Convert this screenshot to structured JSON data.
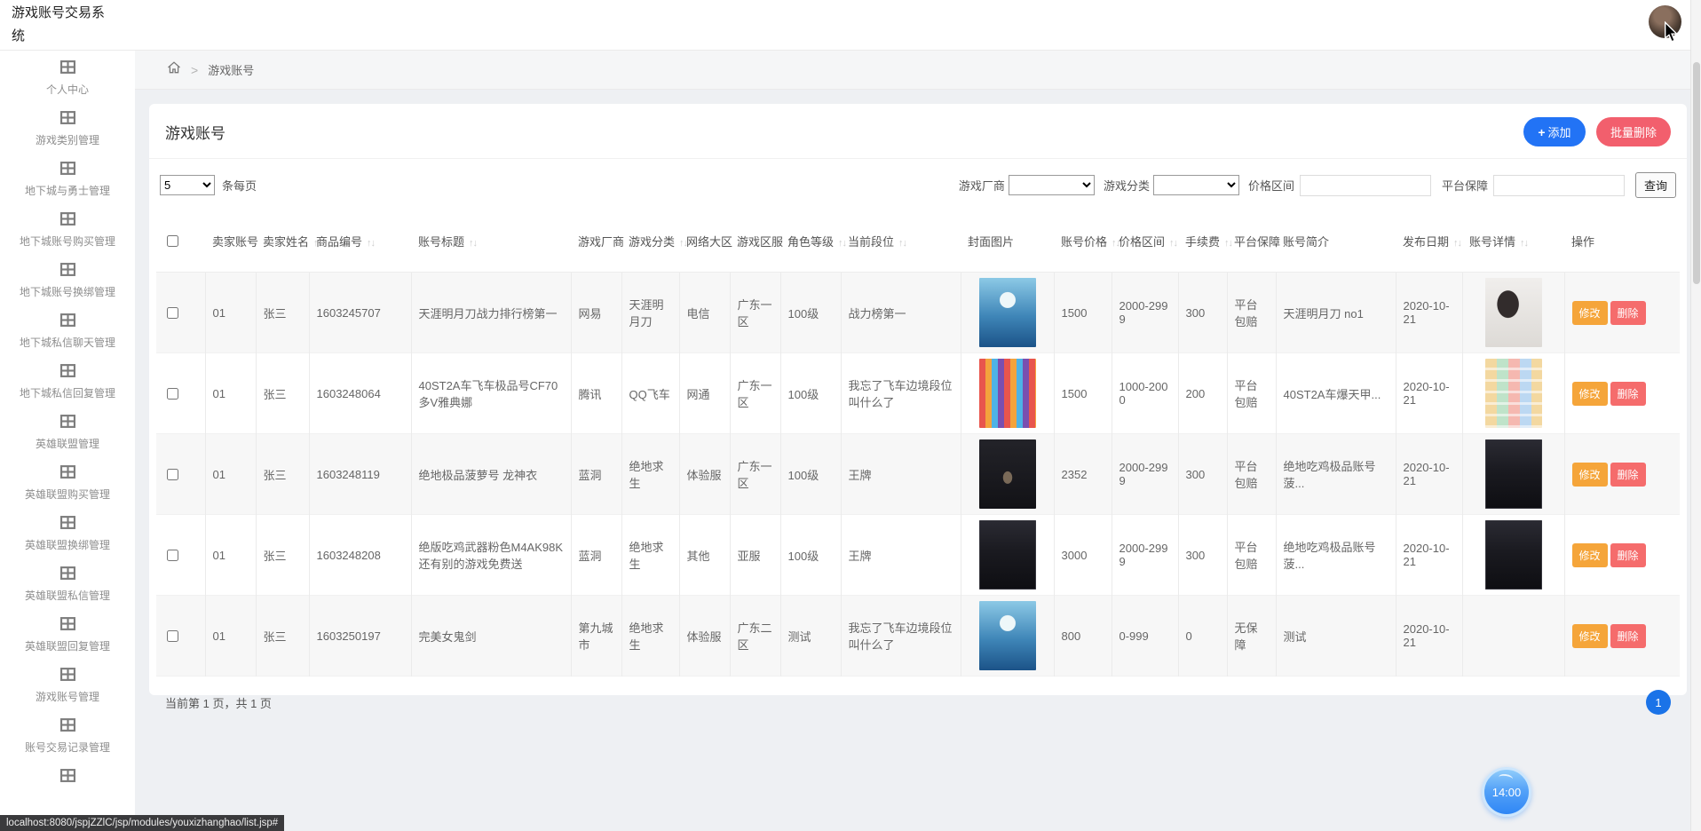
{
  "colors": {
    "primary_blue": "#2273f5",
    "danger_red": "#f25f6d",
    "warning_orange": "#f5a53a",
    "pagination_blue": "#1a73e8"
  },
  "header": {
    "app_title": "游戏账号交易系统"
  },
  "sidebar": {
    "items": [
      {
        "label": "个人中心"
      },
      {
        "label": "游戏类别管理"
      },
      {
        "label": "地下城与勇士管理"
      },
      {
        "label": "地下城账号购买管理"
      },
      {
        "label": "地下城账号换绑管理"
      },
      {
        "label": "地下城私信聊天管理"
      },
      {
        "label": "地下城私信回复管理"
      },
      {
        "label": "英雄联盟管理"
      },
      {
        "label": "英雄联盟购买管理"
      },
      {
        "label": "英雄联盟换绑管理"
      },
      {
        "label": "英雄联盟私信管理"
      },
      {
        "label": "英雄联盟回复管理"
      },
      {
        "label": "游戏账号管理"
      },
      {
        "label": "账号交易记录管理"
      },
      {
        "label": ""
      }
    ]
  },
  "breadcrumb": {
    "current": "游戏账号"
  },
  "page": {
    "title": "游戏账号",
    "add_label": "添加",
    "batch_delete_label": "批量删除"
  },
  "controls": {
    "page_size_value": "5",
    "per_page_label": "条每页",
    "filters": {
      "vendor_label": "游戏厂商",
      "category_label": "游戏分类",
      "price_label": "价格区间",
      "guarantee_label": "平台保障",
      "search_label": "查询"
    }
  },
  "table": {
    "headers": [
      {
        "label": "卖家账号",
        "sortable": true
      },
      {
        "label": "卖家姓名",
        "sortable": true
      },
      {
        "label": "商品编号",
        "sortable": true
      },
      {
        "label": "账号标题",
        "sortable": true
      },
      {
        "label": "游戏厂商",
        "sortable": true
      },
      {
        "label": "游戏分类",
        "sortable": true
      },
      {
        "label": "网络大区",
        "sortable": true
      },
      {
        "label": "游戏区服",
        "sortable": true
      },
      {
        "label": "角色等级",
        "sortable": true
      },
      {
        "label": "当前段位",
        "sortable": true
      },
      {
        "label": "封面图片",
        "sortable": false
      },
      {
        "label": "账号价格",
        "sortable": true
      },
      {
        "label": "价格区间",
        "sortable": true
      },
      {
        "label": "手续费",
        "sortable": true
      },
      {
        "label": "平台保障",
        "sortable": true
      },
      {
        "label": "账号简介",
        "sortable": false
      },
      {
        "label": "发布日期",
        "sortable": true
      },
      {
        "label": "账号详情",
        "sortable": true
      },
      {
        "label": "操作",
        "sortable": false
      }
    ],
    "actions": {
      "edit": "修改",
      "delete": "删除"
    },
    "rows": [
      {
        "account": "01",
        "name": "张三",
        "product_no": "1603245707",
        "title": "天涯明月刀战力排行榜第一",
        "vendor": "网易",
        "category": "天涯明月刀",
        "network": "电信",
        "server": "广东一区",
        "level": "100级",
        "rank": "战力榜第一",
        "cover": "sea-character",
        "price": "1500",
        "price_range": "2000-2999",
        "fee": "300",
        "guarantee": "平台包赔",
        "intro": "天涯明月刀 no1",
        "date": "2020-10-21",
        "detail": "girl-photo"
      },
      {
        "account": "01",
        "name": "张三",
        "product_no": "1603248064",
        "title": "40ST2A车飞车极品号CF70多V雅典娜",
        "vendor": "腾讯",
        "category": "QQ飞车",
        "network": "网通",
        "server": "广东一区",
        "level": "100级",
        "rank": "我忘了飞车边境段位叫什么了",
        "cover": "racer-lineup",
        "price": "1500",
        "price_range": "1000-2000",
        "fee": "200",
        "guarantee": "平台包赔",
        "intro": "40ST2A车爆天甲...",
        "date": "2020-10-21",
        "detail": "item-grid"
      },
      {
        "account": "01",
        "name": "张三",
        "product_no": "1603248119",
        "title": "绝地极品菠萝号 龙神衣",
        "vendor": "蓝洞",
        "category": "绝地求生",
        "network": "体验服",
        "server": "广东一区",
        "level": "100级",
        "rank": "王牌",
        "cover": "dark-figure",
        "price": "2352",
        "price_range": "2000-2999",
        "fee": "300",
        "guarantee": "平台包赔",
        "intro": "绝地吃鸡极品账号 菠...",
        "date": "2020-10-21",
        "detail": "dark-screenshot"
      },
      {
        "account": "01",
        "name": "张三",
        "product_no": "1603248208",
        "title": "绝版吃鸡武器粉色M4AK98K还有别的游戏免费送",
        "vendor": "蓝洞",
        "category": "绝地求生",
        "network": "其他",
        "server": "亚服",
        "level": "100级",
        "rank": "王牌",
        "cover": "dark-screenshot",
        "price": "3000",
        "price_range": "2000-2999",
        "fee": "300",
        "guarantee": "平台包赔",
        "intro": "绝地吃鸡极品账号 菠...",
        "date": "2020-10-21",
        "detail": "dark-screenshot"
      },
      {
        "account": "01",
        "name": "张三",
        "product_no": "1603250197",
        "title": "完美女鬼剑",
        "vendor": "第九城市",
        "category": "绝地求生",
        "network": "体验服",
        "server": "广东二区",
        "level": "测试",
        "rank": "我忘了飞车边境段位叫什么了",
        "cover": "sea-character",
        "price": "800",
        "price_range": "0-999",
        "fee": "0",
        "guarantee": "无保障",
        "intro": "测试",
        "date": "2020-10-21",
        "detail": ""
      }
    ]
  },
  "footer": {
    "page_info": "当前第 1 页，共 1 页",
    "page": "1"
  },
  "clock": {
    "time": "14:00"
  },
  "statusbar": {
    "url": "localhost:8080/jspjZZlC/jsp/modules/youxizhanghao/list.jsp#"
  }
}
